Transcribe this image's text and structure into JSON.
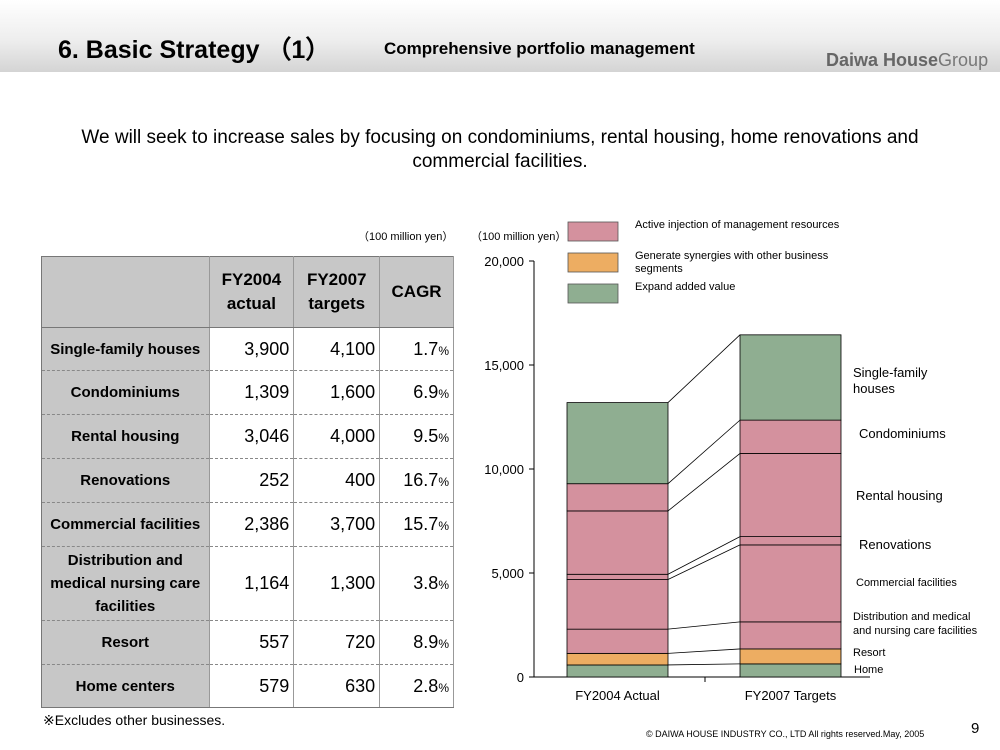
{
  "header": {
    "title": "6. Basic Strategy （1）",
    "subtitle": "Comprehensive portfolio management",
    "logo_bold": "Daiwa House",
    "logo_rest": "Group"
  },
  "lead": "We will seek to increase sales by focusing on condominiums, rental housing, home renovations and commercial facilities.",
  "table": {
    "unit": "（100 million yen）",
    "col1": "FY2004",
    "col1b": "actual",
    "col2": "FY2007",
    "col2b": "targets",
    "col3": "CAGR",
    "pct_sign": "%",
    "rows": [
      {
        "label": "Single-family houses",
        "fy2004": "3,900",
        "fy2007": "4,100",
        "cagr": "1.7"
      },
      {
        "label": "Condominiums",
        "fy2004": "1,309",
        "fy2007": "1,600",
        "cagr": "6.9"
      },
      {
        "label": "Rental housing",
        "fy2004": "3,046",
        "fy2007": "4,000",
        "cagr": "9.5"
      },
      {
        "label": "Renovations",
        "fy2004": "252",
        "fy2007": "400",
        "cagr": "16.7"
      },
      {
        "label": "Commercial facilities",
        "fy2004": "2,386",
        "fy2007": "3,700",
        "cagr": "15.7"
      },
      {
        "label": "Distribution and medical nursing care facilities",
        "fy2004": "1,164",
        "fy2007": "1,300",
        "cagr": "3.8"
      },
      {
        "label": "Resort",
        "fy2004": "557",
        "fy2007": "720",
        "cagr": "8.9"
      },
      {
        "label": "Home centers",
        "fy2004": "579",
        "fy2007": "630",
        "cagr": "2.8"
      }
    ]
  },
  "note": "※Excludes other businesses.",
  "copyright": "© DAIWA HOUSE INDUSTRY CO., LTD All rights reserved.May, 2005",
  "page_number": "9",
  "chart_data": {
    "type": "bar",
    "stacked": true,
    "unit_label": "（100 million yen）",
    "categories": [
      "FY2004 Actual",
      "FY2007 Targets"
    ],
    "ylim": [
      0,
      20000
    ],
    "yticks": [
      0,
      5000,
      10000,
      15000,
      20000
    ],
    "ytick_labels": [
      "0",
      "5,000",
      "10,000",
      "15,000",
      "20,000"
    ],
    "series": [
      {
        "name": "Home",
        "group": "Expand added value",
        "values": [
          579,
          630
        ]
      },
      {
        "name": "Resort",
        "group": "Generate synergies with other business segments",
        "values": [
          557,
          720
        ]
      },
      {
        "name": "Distribution and medical and nursing care facilities",
        "group": "Active injection of management resources",
        "values": [
          1164,
          1300
        ]
      },
      {
        "name": "Commercial facilities",
        "group": "Active injection of management resources",
        "values": [
          2386,
          3700
        ]
      },
      {
        "name": "Renovations",
        "group": "Active injection of management resources",
        "values": [
          252,
          400
        ]
      },
      {
        "name": "Rental housing",
        "group": "Active injection of management resources",
        "values": [
          3046,
          4000
        ]
      },
      {
        "name": "Condominiums",
        "group": "Active injection of management resources",
        "values": [
          1309,
          1600
        ]
      },
      {
        "name": "Single-family houses",
        "group": "Expand added value",
        "values": [
          3900,
          4100
        ]
      }
    ],
    "legend": [
      {
        "label": "Active injection of management resources",
        "color": "#d4919e"
      },
      {
        "label": "Generate synergies with other business segments",
        "color": "#edad62"
      },
      {
        "label": "Expand added value",
        "color": "#8fae91"
      }
    ],
    "legend_position": "top"
  }
}
